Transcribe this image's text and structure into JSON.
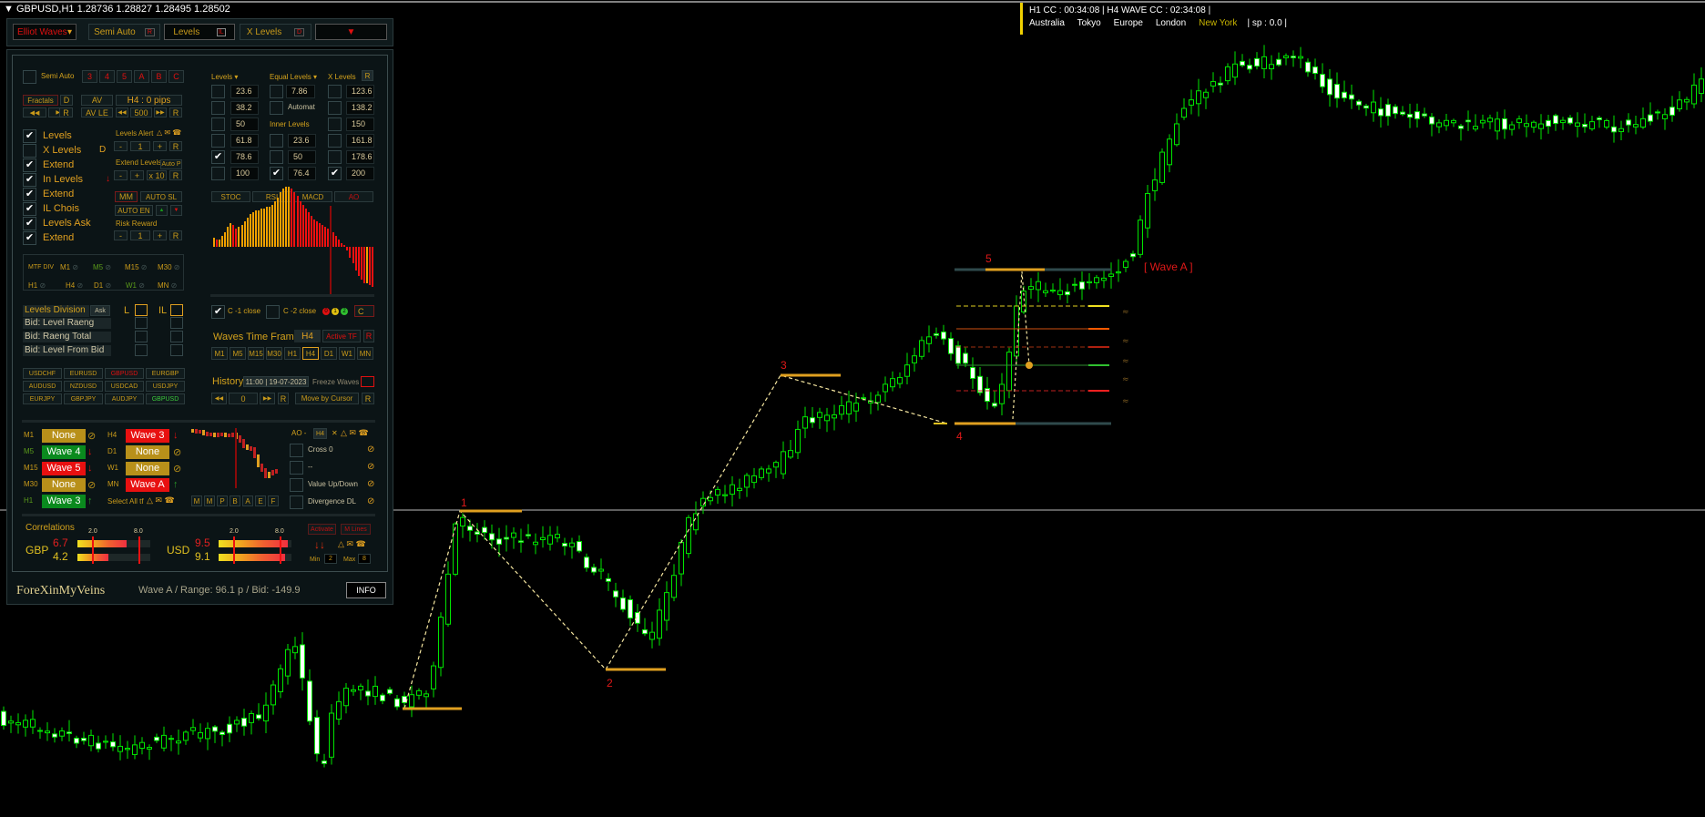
{
  "symbol_header": "GBPUSD,H1  1.28736 1.28827 1.28495 1.28502",
  "topbar": {
    "elliot_waves": "Elliot Waves",
    "semi_auto": "Semi Auto",
    "semi_auto_badge": "R",
    "levels": "Levels",
    "levels_badge": "IL",
    "x_levels": "X Levels",
    "x_levels_badge": "D"
  },
  "info_overlay": {
    "line1": "H1 CC : 00:34:08  |  H4 WAVE CC : 02:34:08  |",
    "sessions": [
      "Australia",
      "Tokyo",
      "Europe",
      "London",
      "New York"
    ],
    "active_session": "New York",
    "active_session_color": "#c8b400",
    "spread": "|  sp : 0.0  |"
  },
  "panel": {
    "semi": {
      "label": "Semi Auto",
      "wave_buttons": [
        "3",
        "4",
        "5",
        "A",
        "B",
        "C"
      ]
    },
    "fractals": {
      "fractals": "Fractals",
      "d": "D",
      "av": "AV",
      "h4_pips": "H4 : 0  pips",
      "av_le": "AV LE",
      "value": "500",
      "prev": "◀◀",
      "next": "▶▶",
      "r": "R"
    },
    "checks": [
      {
        "label": "Levels",
        "checked": true,
        "suffix": ""
      },
      {
        "label": "X Levels",
        "checked": false,
        "suffix": "D"
      },
      {
        "label": "Extend",
        "checked": true,
        "suffix": ""
      },
      {
        "label": "In Levels",
        "checked": true,
        "suffix": "↓"
      },
      {
        "label": "Extend",
        "checked": true,
        "suffix": ""
      },
      {
        "label": "IL Chois",
        "checked": true,
        "suffix": ""
      },
      {
        "label": "Levels Ask",
        "checked": true,
        "suffix": ""
      },
      {
        "label": "Extend",
        "checked": true,
        "suffix": ""
      }
    ],
    "alerts": {
      "levels_alert": "Levels Alert",
      "alert_value": "1",
      "minus": "-",
      "plus": "+",
      "r": "R",
      "extend_levels": "Extend Levels",
      "auto_p": "Auto P",
      "x10": "x 10",
      "mm": "MM",
      "auto_sl": "AUTO SL",
      "auto_en": "AUTO EN",
      "up": "▲",
      "down": "▼",
      "risk_reward": "Risk Reward",
      "rr_value": "1"
    },
    "levels": {
      "header": "Levels ▾",
      "rows": [
        {
          "v": "23.6",
          "c": false
        },
        {
          "v": "38.2",
          "c": false
        },
        {
          "v": "50",
          "c": false
        },
        {
          "v": "61.8",
          "c": false
        },
        {
          "v": "78.6",
          "c": true
        },
        {
          "v": "100",
          "c": false
        }
      ]
    },
    "equal": {
      "header": "Equal Levels ▾",
      "value": "7.86",
      "automat": "Automat",
      "inner_header": "Inner Levels",
      "inner": [
        {
          "v": "23.6",
          "c": false
        },
        {
          "v": "50",
          "c": false
        },
        {
          "v": "76.4",
          "c": true
        }
      ]
    },
    "x_levels": {
      "header": "X Levels",
      "r": "R",
      "rows": [
        {
          "v": "123.6",
          "c": false
        },
        {
          "v": "138.2",
          "c": false
        },
        {
          "v": "150",
          "c": false
        },
        {
          "v": "161.8",
          "c": false
        },
        {
          "v": "178.6",
          "c": false
        },
        {
          "v": "200",
          "c": true
        }
      ]
    },
    "osc_tabs": [
      "STOC",
      "RSI",
      "MACD",
      "AO"
    ],
    "osc_active": "AO",
    "ao_histogram": [
      5,
      4,
      4,
      6,
      8,
      11,
      13,
      12,
      10,
      11,
      12,
      14,
      16,
      18,
      19,
      20,
      20,
      21,
      21,
      22,
      22,
      23,
      25,
      27,
      30,
      32,
      33,
      33,
      32,
      30,
      28,
      25,
      23,
      21,
      19,
      17,
      15,
      14,
      13,
      12,
      11,
      10,
      9,
      8,
      6,
      4,
      2,
      1,
      -2,
      -6,
      -9,
      -13,
      -16,
      -18,
      -20,
      -20,
      -21,
      -22
    ],
    "mtf": {
      "label": "MTF DIV",
      "tfs": [
        "M1",
        "M5",
        "M15",
        "M30",
        "H1",
        "H4",
        "D1",
        "W1",
        "MN"
      ]
    },
    "c_close": {
      "c1": "C -1 close",
      "c1_checked": true,
      "c2": "C -2 close",
      "c2_checked": false,
      "dots": [
        "0",
        "1",
        "2"
      ],
      "c": "C",
      "c_badge": "A"
    },
    "levels_division": {
      "title": "Levels Division",
      "ask": "Ask",
      "l": "L",
      "il": "IL",
      "rows": [
        "Bid: Level Raeng",
        "Bid: Raeng Total",
        "Bid: Level From Bid"
      ]
    },
    "waves_tf": {
      "title": "Waves Time Frame",
      "current": "H4",
      "active_tf": "Active TF",
      "r": "R",
      "tfs": [
        "M1",
        "M5",
        "M15",
        "M30",
        "H1",
        "H4",
        "D1",
        "W1",
        "MN"
      ],
      "selected": "H4"
    },
    "pairs": [
      {
        "n": "USDCHF",
        "color": "#c99a1a"
      },
      {
        "n": "EURUSD",
        "color": "#c99a1a"
      },
      {
        "n": "GBPUSD",
        "color": "#e01010"
      },
      {
        "n": "EURGBP",
        "color": "#c99a1a"
      },
      {
        "n": "AUDUSD",
        "color": "#c99a1a"
      },
      {
        "n": "NZDUSD",
        "color": "#c99a1a"
      },
      {
        "n": "USDCAD",
        "color": "#c99a1a"
      },
      {
        "n": "USDJPY",
        "color": "#c99a1a"
      },
      {
        "n": "EURJPY",
        "color": "#c99a1a"
      },
      {
        "n": "GBPJPY",
        "color": "#c99a1a"
      },
      {
        "n": "AUDJPY",
        "color": "#c99a1a"
      },
      {
        "n": "GBPUSD",
        "color": "#3cc83c"
      }
    ],
    "history": {
      "label": "History",
      "date": "11:00 | 19-07-2023",
      "freeze": "Freeze Waves",
      "prev": "◀◀",
      "value": "0",
      "next": "▶▶",
      "r": "R",
      "move": "Move by Cursor"
    },
    "waves_status": {
      "left": [
        {
          "tf": "M1",
          "wave": "None",
          "state": "none",
          "icon": "⊘"
        },
        {
          "tf": "M5",
          "wave": "Wave 4",
          "state": "green",
          "icon": "↓"
        },
        {
          "tf": "M15",
          "wave": "Wave 5",
          "state": "red",
          "icon": "↓"
        },
        {
          "tf": "M30",
          "wave": "None",
          "state": "none",
          "icon": "⊘"
        },
        {
          "tf": "H1",
          "wave": "Wave 3",
          "state": "green",
          "icon": "↑"
        }
      ],
      "right": [
        {
          "tf": "H4",
          "wave": "Wave 3",
          "state": "red",
          "icon": "↓"
        },
        {
          "tf": "D1",
          "wave": "None",
          "state": "none",
          "icon": "⊘"
        },
        {
          "tf": "W1",
          "wave": "None",
          "state": "none",
          "icon": "⊘"
        },
        {
          "tf": "MN",
          "wave": "Wave A",
          "state": "red",
          "icon": "↑"
        }
      ],
      "select_all": "Select All tf",
      "colors": {
        "none": "#b8901a",
        "green": "#0a8a1e",
        "red": "#e81010"
      }
    },
    "mini_buttons": [
      "M",
      "M",
      "P",
      "B",
      "A",
      "E",
      "F"
    ],
    "ao_alert": {
      "label": "AO -",
      "tf": "H4",
      "x": "✕",
      "options": [
        "Cross 0",
        "--",
        "Value Up/Down",
        "Divergence  DL"
      ]
    },
    "correlations": {
      "title": "Correlations",
      "scale": [
        "2.0",
        "8.0"
      ],
      "scale_max": 10,
      "gbp": {
        "name": "GBP",
        "values": [
          6.7,
          4.2
        ]
      },
      "usd": {
        "name": "USD",
        "values": [
          9.5,
          9.1
        ]
      },
      "activate": "Activate",
      "m_lines": "M Lines",
      "arrows": "↓↓",
      "min_label": "Min",
      "min": "2",
      "max_label": "Max",
      "max": "8"
    },
    "footer": {
      "brand": "ForeXinMyVeins",
      "status": "Wave A  /  Range: 96.1 p  /  Bid: -149.9",
      "info": "INFO"
    }
  },
  "chart": {
    "wave_labels": [
      "1",
      "2",
      "3",
      "4",
      "5"
    ],
    "wave_a": "[ Wave A ]",
    "candle_colors": {
      "outline": "#00e600",
      "fill": "#ffffff"
    }
  }
}
